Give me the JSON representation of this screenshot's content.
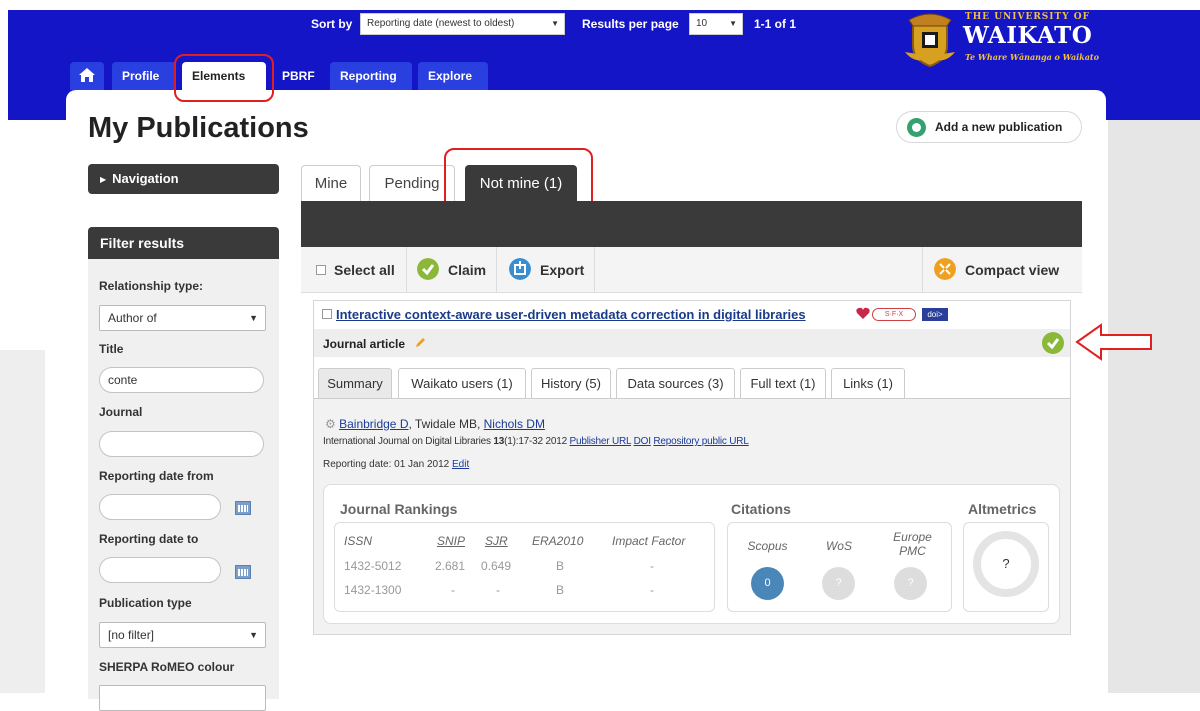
{
  "logo": {
    "small_text": "THE UNIVERSITY OF",
    "big_text": "WAIKATO",
    "motto": "Te Whare Wānanga o Waikato"
  },
  "nav_tabs": [
    "Profile",
    "Elements",
    "PBRF",
    "Reporting",
    "Explore"
  ],
  "page_title": "My Publications",
  "add_button": "Add a new publication",
  "navigation_label": "Navigation",
  "filter": {
    "header": "Filter results",
    "relationship_label": "Relationship type:",
    "relationship_value": "Author of",
    "title_label": "Title",
    "title_value": "conte",
    "journal_label": "Journal",
    "journal_value": "",
    "date_from_label": "Reporting date from",
    "date_to_label": "Reporting date to",
    "pubtype_label": "Publication type",
    "pubtype_value": "[no filter]",
    "sherpa_label": "SHERPA RoMEO colour"
  },
  "list_tabs": [
    "Mine",
    "Pending",
    "Not mine (1)"
  ],
  "sort": {
    "sort_label": "Sort by",
    "sort_value": "Reporting date (newest to oldest)",
    "per_page_label": "Results per page",
    "per_page_value": "10",
    "count": "1-1 of 1"
  },
  "actions": {
    "select_all": "Select all",
    "claim": "Claim",
    "export": "Export",
    "compact": "Compact view"
  },
  "publication": {
    "title": "Interactive context-aware user-driven metadata correction in digital libraries",
    "type": "Journal article",
    "tabs": [
      "Summary",
      "Waikato users (1)",
      "History (5)",
      "Data sources (3)",
      "Full text (1)",
      "Links (1)"
    ],
    "author1": "Bainbridge D",
    "author2": ", Twidale MB, ",
    "author3": "Nichols DM",
    "journal": "International Journal on Digital Libraries ",
    "volume": "13",
    "issue_pages": "(1):17-32 2012 ",
    "publisher_url": "Publisher URL",
    "doi": "DOI",
    "repo_url": "Repository public URL",
    "reporting_date_label": "Reporting date: 01 Jan 2012 ",
    "edit": "Edit",
    "sfx": "S·F·X",
    "doi_badge": "doi>"
  },
  "metrics": {
    "rankings_title": "Journal Rankings",
    "citations_title": "Citations",
    "altmetrics_title": "Altmetrics",
    "rank_headers": [
      "ISSN",
      "SNIP",
      "SJR",
      "ERA2010",
      "Impact Factor"
    ],
    "rank_rows": [
      [
        "1432-5012",
        "2.681",
        "0.649",
        "B",
        "-"
      ],
      [
        "1432-1300",
        "-",
        "-",
        "B",
        "-"
      ]
    ],
    "citation_sources": [
      "Scopus",
      "WoS",
      "Europe PMC"
    ],
    "scopus_count": "0",
    "wos_count": "?",
    "pmc_count": "?",
    "altmetric_value": "?"
  },
  "colors": {
    "brand_blue": "#1515c8",
    "dark_bar": "#3a3a3a",
    "highlight_red": "#e02020",
    "claim_green": "#8cb83a",
    "export_blue": "#3a8ed0",
    "compact_orange": "#f0a020"
  }
}
